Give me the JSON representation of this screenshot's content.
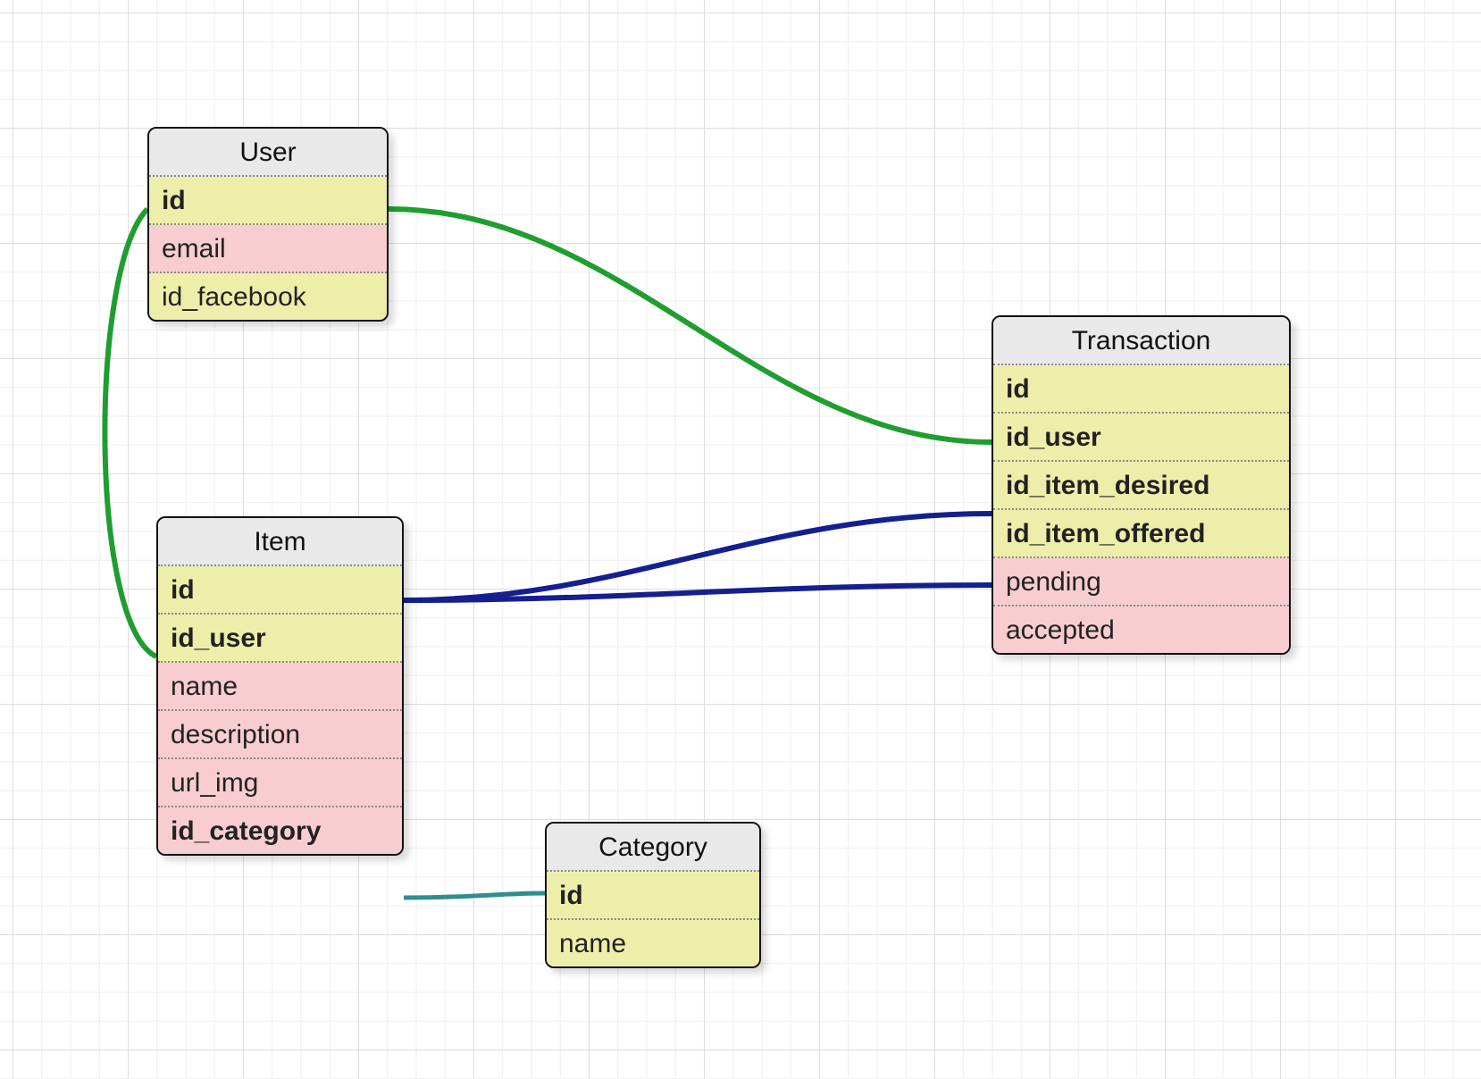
{
  "entities": {
    "user": {
      "title": "User",
      "fields": {
        "id": "id",
        "email": "email",
        "id_facebook": "id_facebook"
      }
    },
    "item": {
      "title": "Item",
      "fields": {
        "id": "id",
        "id_user": "id_user",
        "name": "name",
        "description": "description",
        "url_img": "url_img",
        "id_category": "id_category"
      }
    },
    "transaction": {
      "title": "Transaction",
      "fields": {
        "id": "id",
        "id_user": "id_user",
        "id_item_desired": "id_item_desired",
        "id_item_offered": "id_item_offered",
        "pending": "pending",
        "accepted": "accepted"
      }
    },
    "category": {
      "title": "Category",
      "fields": {
        "id": "id",
        "name": "name"
      }
    }
  },
  "connections": [
    {
      "from": "user.id",
      "to": "transaction.id_user",
      "color": "green"
    },
    {
      "from": "user.id",
      "to": "item.id_user",
      "color": "green"
    },
    {
      "from": "item.id",
      "to": "transaction.id_item_desired",
      "color": "navy"
    },
    {
      "from": "item.id",
      "to": "transaction.id_item_offered",
      "color": "navy"
    },
    {
      "from": "item.id_category",
      "to": "category.id",
      "color": "teal"
    }
  ],
  "colors": {
    "green": "#1f9e2f",
    "navy": "#151f8f",
    "teal": "#2f8f8f"
  }
}
